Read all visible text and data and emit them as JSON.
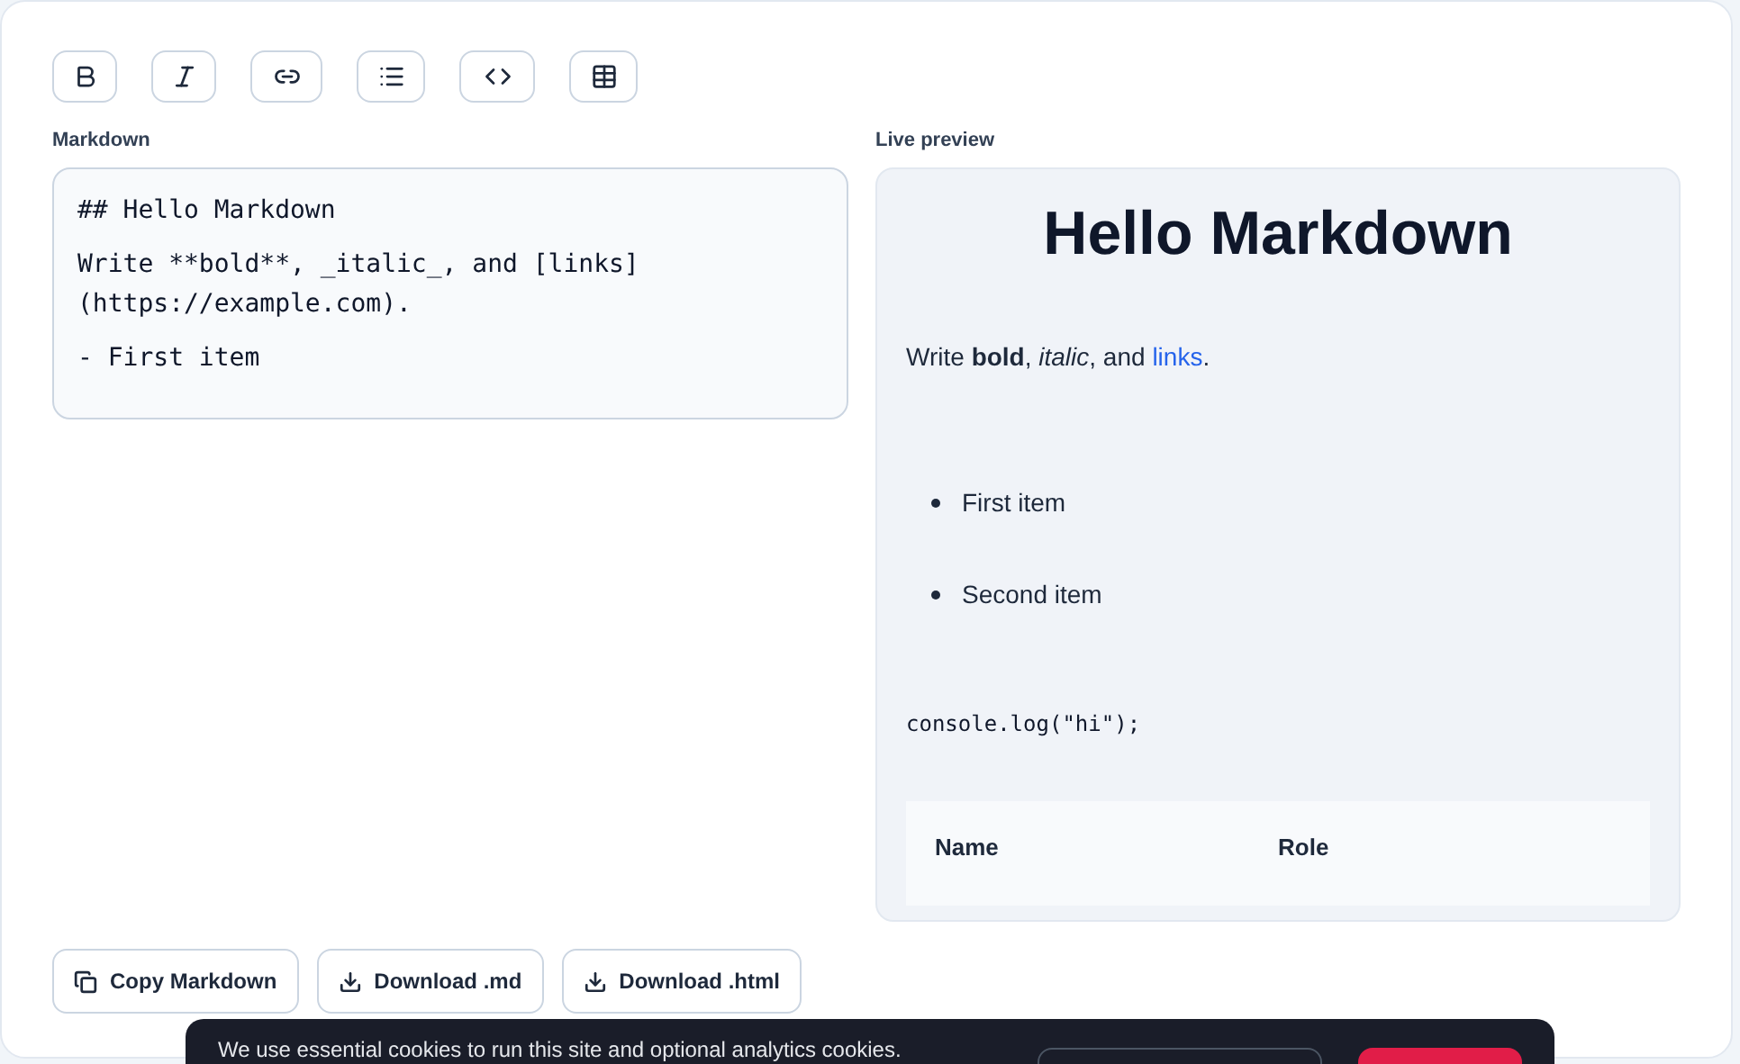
{
  "toolbar": [
    {
      "kind": "bold"
    },
    {
      "kind": "italic"
    },
    {
      "kind": "link"
    },
    {
      "kind": "list"
    },
    {
      "kind": "code"
    },
    {
      "kind": "table"
    }
  ],
  "editor": {
    "label": "Markdown",
    "blocks": [
      [
        "## Hello Markdown"
      ],
      [
        "Write **bold**, _italic_, and [links]",
        "(https://example.com)."
      ],
      [
        "- First item"
      ]
    ]
  },
  "preview": {
    "label": "Live preview",
    "heading": "Hello Markdown",
    "paragraph": {
      "text": "Write **bold**, *italic*, and",
      "link": "links",
      "end": "."
    },
    "list": [
      "First item",
      "Second item"
    ],
    "code": "console.log(\"hi\");",
    "table_columns": [
      "Name",
      "Role"
    ]
  },
  "actions": [
    {
      "kind": "copy",
      "label": "Copy Markdown"
    },
    {
      "kind": "download",
      "label": "Download .md"
    },
    {
      "kind": "download",
      "label": "Download .html"
    }
  ],
  "cookie_banner": {
    "text": "We use essential cookies to run this site and optional analytics cookies."
  }
}
